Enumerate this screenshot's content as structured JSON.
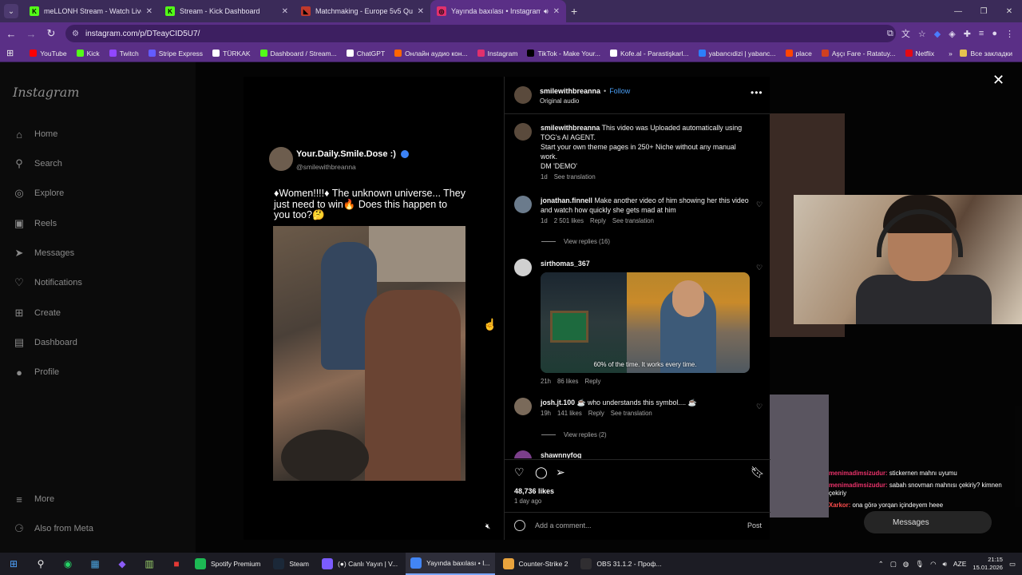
{
  "tabs": [
    {
      "title": "meLLONH Stream - Watch Live",
      "color": "#53fc18",
      "glyph": "K",
      "active": false
    },
    {
      "title": "Stream - Kick Dashboard",
      "color": "#53fc18",
      "glyph": "K",
      "active": false
    },
    {
      "title": "Matchmaking - Europe 5v5 Qu",
      "color": "#c0392b",
      "glyph": "◣",
      "active": false
    },
    {
      "title": "Yayında baxılası • Instagram",
      "color": "#e1306c",
      "glyph": "◎",
      "active": true
    }
  ],
  "address": {
    "url": "instagram.com/p/DTeayCID5U7/"
  },
  "bookmarks": [
    {
      "label": "YouTube",
      "color": "#ff0000"
    },
    {
      "label": "Kick",
      "color": "#53fc18"
    },
    {
      "label": "Twitch",
      "color": "#9146ff"
    },
    {
      "label": "Stripe Express",
      "color": "#635bff"
    },
    {
      "label": "TÜRKAK",
      "color": "#ffffff"
    },
    {
      "label": "Dashboard / Stream...",
      "color": "#53fc18"
    },
    {
      "label": "ChatGPT",
      "color": "#ffffff"
    },
    {
      "label": "Онлайн аудио кон...",
      "color": "#ff6600"
    },
    {
      "label": "Instagram",
      "color": "#e1306c"
    },
    {
      "label": "TikTok - Make Your...",
      "color": "#000000"
    },
    {
      "label": "Kofe.al - Parastişkarl...",
      "color": "#ffffff"
    },
    {
      "label": "yabancıdizi | yabanc...",
      "color": "#2d7ff9"
    },
    {
      "label": "place",
      "color": "#ff4500"
    },
    {
      "label": "Aşçı Fare - Ratatuy...",
      "color": "#d04020"
    },
    {
      "label": "Netflix",
      "color": "#e50914"
    }
  ],
  "bookmarks_other": "Все закладки",
  "sidebar": {
    "logo": "Instagram",
    "items": [
      {
        "label": "Home",
        "icon": "home-icon",
        "glyph": "⌂"
      },
      {
        "label": "Search",
        "icon": "search-icon",
        "glyph": "⚲"
      },
      {
        "label": "Explore",
        "icon": "explore-icon",
        "glyph": "◎"
      },
      {
        "label": "Reels",
        "icon": "reels-icon",
        "glyph": "▣"
      },
      {
        "label": "Messages",
        "icon": "messages-icon",
        "glyph": "➤"
      },
      {
        "label": "Notifications",
        "icon": "heart-icon",
        "glyph": "♡"
      },
      {
        "label": "Create",
        "icon": "create-icon",
        "glyph": "⊞"
      },
      {
        "label": "Dashboard",
        "icon": "dashboard-icon",
        "glyph": "▤"
      },
      {
        "label": "Profile",
        "icon": "profile-icon",
        "glyph": "●"
      }
    ],
    "more": "More",
    "meta": "Also from Meta"
  },
  "post_card": {
    "name": "Your.Daily.Smile.Dose :)",
    "handle": "@smilewithbreanna",
    "caption": "♦Women!!!!♦ The unknown universe... They just need to win🔥 Does this happen to you too?🤔"
  },
  "panel": {
    "username": "smilewithbreanna",
    "dot": "•",
    "follow": "Follow",
    "audio": "Original audio",
    "caption_user": "smilewithbreanna",
    "caption_text": "This video was Uploaded automatically using TOG's AI AGENT.",
    "caption_line2": "Start your own theme pages in 250+ Niche without any manual work.",
    "caption_line3": "DM 'DEMO'",
    "caption_age": "1d",
    "caption_translate": "See translation",
    "comments": [
      {
        "user": "jonathan.finnell",
        "text": "Make another video of him showing her this video and watch how quickly she gets mad at him",
        "age": "1d",
        "likes": "2 501 likes",
        "reply": "Reply",
        "translate": "See translation",
        "view_replies": "View replies (16)"
      },
      {
        "user": "sirthomas_367",
        "text": "",
        "age": "21h",
        "likes": "86 likes",
        "reply": "Reply",
        "gif_caption": "60% of the time. It works every time."
      },
      {
        "user": "josh.jt.100",
        "text": "☕ who understands this symbol.... ☕",
        "age": "19h",
        "likes": "141 likes",
        "reply": "Reply",
        "translate": "See translation",
        "view_replies": "View replies (2)"
      },
      {
        "user": "shawnnyfog",
        "text": ""
      }
    ],
    "likes": "48,736 likes",
    "date": "1 day ago",
    "add_comment_placeholder": "Add a comment...",
    "post_label": "Post"
  },
  "stream_chat": [
    {
      "user": "menimadimsizudur:",
      "text": "stickernen mahnı uyumu"
    },
    {
      "user": "menimadimsizudur:",
      "text": "sabah snovman mahnısı çekiriy? kimnen çekiriy"
    },
    {
      "user": "Xarkor:",
      "text": "ona görə yorqan içindeyem heee"
    }
  ],
  "messages_pill": "Messages",
  "taskbar": {
    "apps": [
      {
        "label": "Spotify Premium",
        "color": "#1db954",
        "active": false
      },
      {
        "label": "Steam",
        "color": "#1b2838",
        "active": false
      },
      {
        "label": "(●) Canlı Yayın | V...",
        "color": "#7b5cff",
        "active": false
      },
      {
        "label": "Yayında baxılası • I...",
        "color": "#4285f4",
        "active": true
      },
      {
        "label": "Counter-Strike 2",
        "color": "#e8a33d",
        "active": false
      },
      {
        "label": "OBS 31.1.2 - Проф...",
        "color": "#302e31",
        "active": false
      }
    ],
    "lang": "AZE",
    "time": "21:15",
    "date": "15.01.2026"
  }
}
